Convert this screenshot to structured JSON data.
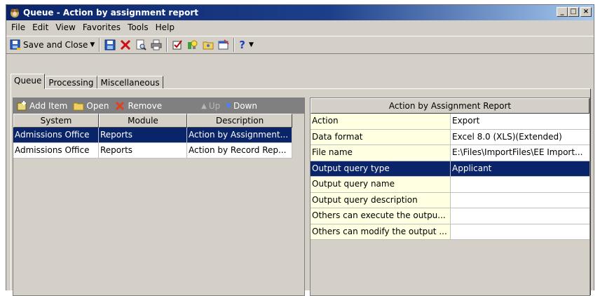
{
  "window": {
    "title": "Queue - Action by assignment report",
    "btn_min": "_",
    "btn_max": "□",
    "btn_close": "×"
  },
  "menu": [
    "File",
    "Edit",
    "View",
    "Favorites",
    "Tools",
    "Help"
  ],
  "menu_accel": [
    "F",
    "E",
    "V",
    "a",
    "T",
    "H"
  ],
  "toolbar": {
    "save_close_label": "Save and Close",
    "help_label": "?"
  },
  "tabs": [
    {
      "label": "Queue",
      "active": true
    },
    {
      "label": "Processing",
      "active": false
    },
    {
      "label": "Miscellaneous",
      "active": false
    }
  ],
  "left_toolbar": {
    "add_item": "Add Item",
    "open": "Open",
    "remove": "Remove",
    "up": "Up",
    "down": "Down"
  },
  "grid": {
    "columns": [
      "System",
      "Module",
      "Description"
    ],
    "rows": [
      {
        "system": "Admissions Office",
        "module": "Reports",
        "description": "Action by Assignment...",
        "selected": true
      },
      {
        "system": "Admissions Office",
        "module": "Reports",
        "description": "Action by Record Rep...",
        "selected": false
      }
    ]
  },
  "properties": {
    "header": "Action by Assignment Report",
    "rows": [
      {
        "key": "Action",
        "value": "Export",
        "selected": false
      },
      {
        "key": "Data format",
        "value": "Excel 8.0 (XLS)(Extended)",
        "selected": false
      },
      {
        "key": "File name",
        "value": "E:\\Files\\ImportFiles\\EE Import...",
        "selected": false
      },
      {
        "key": "Output query type",
        "value": "Applicant",
        "selected": true
      },
      {
        "key": "Output query name",
        "value": "",
        "selected": false
      },
      {
        "key": "Output query description",
        "value": "",
        "selected": false
      },
      {
        "key": "Others can execute the outpu...",
        "value": "",
        "selected": false
      },
      {
        "key": "Others can modify the output ...",
        "value": "",
        "selected": false
      }
    ]
  },
  "colors": {
    "selection": "#0a246a",
    "title_gradient_start": "#0a246a",
    "property_key_bg": "#ffffe1"
  }
}
